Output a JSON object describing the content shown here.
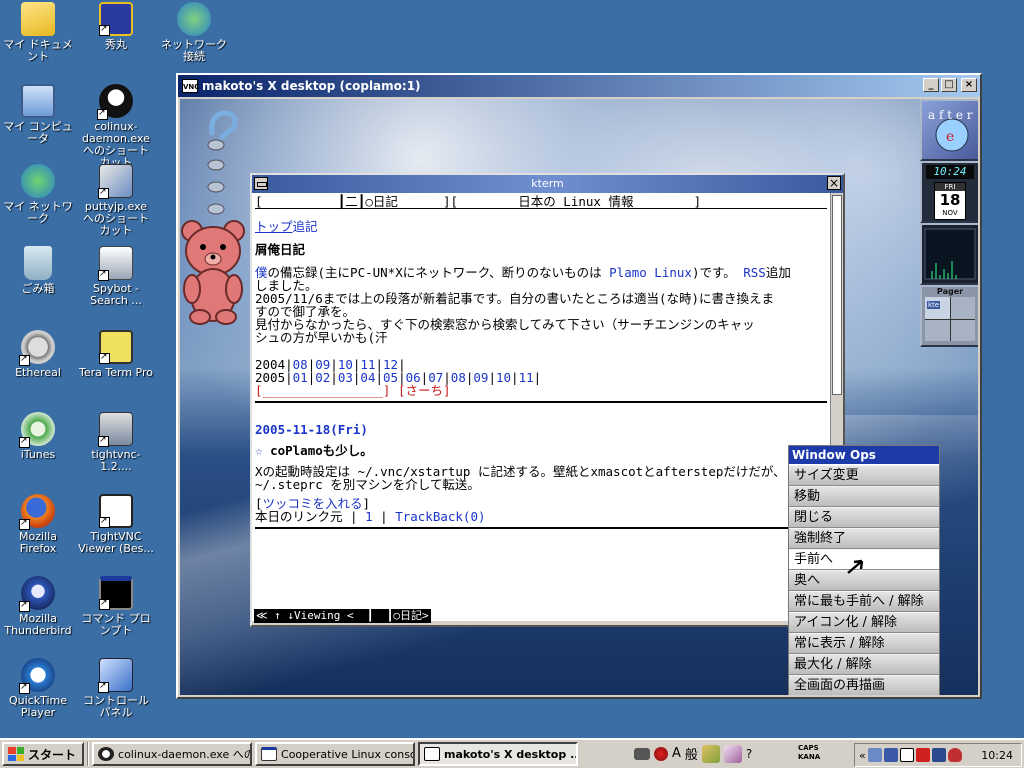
{
  "desktop": {
    "icons": [
      {
        "label": "マイ ドキュメント"
      },
      {
        "label": "秀丸"
      },
      {
        "label": "ネットワーク接続"
      },
      {
        "label": "マイ コンピュータ"
      },
      {
        "label": "colinux-daemon.exe へのショートカット"
      },
      {
        "label": "マイ ネットワーク"
      },
      {
        "label": "puttyjp.exe へのショートカット"
      },
      {
        "label": "ごみ箱"
      },
      {
        "label": "Spybot - Search ..."
      },
      {
        "label": "Ethereal"
      },
      {
        "label": "Tera Term Pro"
      },
      {
        "label": "iTunes"
      },
      {
        "label": "tightvnc-1.2...."
      },
      {
        "label": "Mozilla Firefox"
      },
      {
        "label": "TightVNC Viewer (Bes..."
      },
      {
        "label": "Mozilla Thunderbird"
      },
      {
        "label": "コマンド プロンプト"
      },
      {
        "label": "QuickTime Player"
      },
      {
        "label": "コントロール パネル"
      }
    ]
  },
  "vnc_window": {
    "title": "makoto's X desktop (coplamo:1)",
    "icon_text": "VNC"
  },
  "wharf": {
    "clock_time": "10:24",
    "calendar_day": "FRI",
    "calendar_date": "18",
    "calendar_month": "NOV",
    "pager_label": "Pager",
    "pager_tag": "kte"
  },
  "kterm": {
    "title": "kterm",
    "lines": {
      "header_left": "[          ┃二┃○日記",
      "header_mid": "      ][",
      "header_right": "        日本の Linux 情報        ]",
      "top_link": "トップ",
      "tsukkomi_link": "追記",
      "diary_title": "屑俺日記",
      "p1_a": "僕",
      "p1_b": "の備忘録(主にPC-UN*Xにネットワーク、断りのないものは",
      "p1_c": "Plamo Linux",
      "p1_d": ")です。",
      "p1_e": "RSS",
      "p1_f": "追加",
      "p2": "しました。",
      "p3": "2005/11/6までは上の段落が新着記事です。自分の書いたところは適当(な時)に書き換えま",
      "p4": "すので御了承を。",
      "p5": "見付からなかったら、すぐ下の検索窓から検索してみて下さい（サーチエンジンのキャッ",
      "p6": "シュの方が早いかも(汗",
      "y2004_label": "2004",
      "y2004_months": [
        "08",
        "09",
        "10",
        "11",
        "12"
      ],
      "y2005_label": "2005",
      "y2005_months": [
        "01",
        "02",
        "03",
        "04",
        "05",
        "06",
        "07",
        "08",
        "09",
        "10",
        "11"
      ],
      "search_field": "[________________]",
      "search_button": "[さーち]",
      "date": "2005-11-18(Fri)",
      "entry_mark": "☆",
      "entry_title": "coPlamoも少し。",
      "body1": "Xの起動時設定は ~/.vnc/xstartup に記述する。壁紙とxmascotとafterstepだけだが、",
      "body2": "~/.steprc を別マシンを介して転送。",
      "tsukkomi": "ツッコミを入れる",
      "links_label": "本日のリンク元",
      "links_count": "1",
      "trackback": "TrackBack(0)",
      "status": "≪ ↑ ↓Viewing <  ┃  ┃○日記>"
    }
  },
  "window_ops": {
    "title": "Window Ops",
    "items": [
      "サイズ変更",
      "移動",
      "閉じる",
      "強制終了",
      "手前へ",
      "奥へ",
      "常に最も手前へ / 解除",
      "アイコン化 / 解除",
      "常に表示 / 解除",
      "最大化 / 解除",
      "全画面の再描画"
    ],
    "highlighted": "手前へ"
  },
  "taskbar": {
    "start_label": "スタート",
    "buttons": [
      {
        "label": "colinux-daemon.exe への..."
      },
      {
        "label": "Cooperative Linux conso..."
      },
      {
        "label": "makoto's X desktop ..."
      }
    ],
    "ime_label": "般",
    "ime_a": "A",
    "caps": "CAPS",
    "kana": "KANA",
    "clock": "10:24"
  },
  "colors": {
    "desktop_bg": "#3a6ea5",
    "title_active": "#0a246a",
    "link_blue": "#1a34c8",
    "link_red": "#c81a1a",
    "menu_header": "#1c3aa8"
  }
}
